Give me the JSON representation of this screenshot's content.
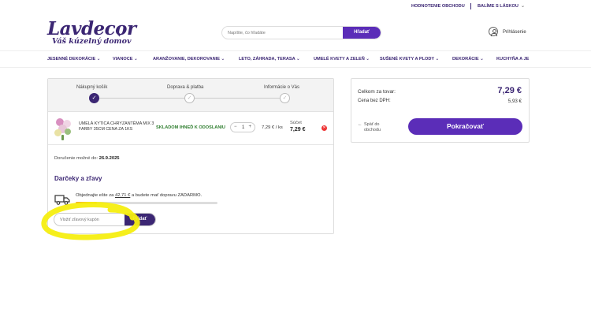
{
  "topbar": {
    "link_reviews": "HODNOTENIE OBCHODU",
    "link_packing": "BALÍME S LÁSKOU",
    "chevron": "⌄"
  },
  "logo": {
    "main": "Lavdecor",
    "tagline": "Váš kúzelný domov"
  },
  "search": {
    "placeholder": "Napíšte, čo hľadáte",
    "button": "Hľadať"
  },
  "account": {
    "login": "Prihlásenie",
    "icon": "user-icon"
  },
  "nav": {
    "items": [
      "JESENNÉ DEKORÁCIE ⌄",
      "VIANOCE ⌄",
      "ARANŽOVANIE, DEKOROVANIE ⌄",
      "LETO, ZÁHRADA, TERASA ⌄",
      "UMELÉ KVETY A ZELEŇ ⌄",
      "SUŠENÉ KVETY A PLODY ⌄",
      "DEKORÁCIE ⌄",
      "KUCHYŇA A JE"
    ]
  },
  "steps": [
    {
      "label": "Nákupný košík",
      "state": "active",
      "mark": "✓"
    },
    {
      "label": "Doprava & platba",
      "state": "pending",
      "mark": "✓"
    },
    {
      "label": "Informácie o Vás",
      "state": "pending",
      "mark": "✓"
    }
  ],
  "cart_item": {
    "name": "UMELÁ KYTICA CHRYZANTÉMA MIX 3 FARBY 35CM CENA ZA 1KS",
    "stock": "SKLADOM IHNEĎ K ODOSLANIU",
    "qty_minus": "−",
    "qty": "1",
    "qty_plus": "+",
    "unit_price": "7,29 € / ks",
    "sum_label": "Súčet",
    "sum_value": "7,29 €",
    "remove_icon": "✕"
  },
  "delivery": {
    "label": "Doručenie možné do:",
    "date": "26.9.2025"
  },
  "gifts": {
    "title": "Darčeky a zľavy",
    "shipping_text_prefix": "Objednajte ešte za",
    "shipping_amount": "42,71 €",
    "shipping_text_suffix": "a budete mať dopravu ZADARMO.",
    "progress_ratio": 0.15
  },
  "coupon": {
    "placeholder": "Vložiť zľavový kupón",
    "button": "Pridať"
  },
  "summary": {
    "total_label": "Celkom za tovar:",
    "total_value": "7,29 €",
    "net_label": "Cena bez DPH:",
    "net_value": "5,93 €",
    "back_arrow": "←",
    "back_label": "Späť do obchodu",
    "continue": "Pokračovať"
  },
  "colors": {
    "brand": "#3b2673",
    "accent": "#5b2db8",
    "stock": "#2d7d2d",
    "highlight": "#f5ee10",
    "progress": "#f4a62a"
  }
}
